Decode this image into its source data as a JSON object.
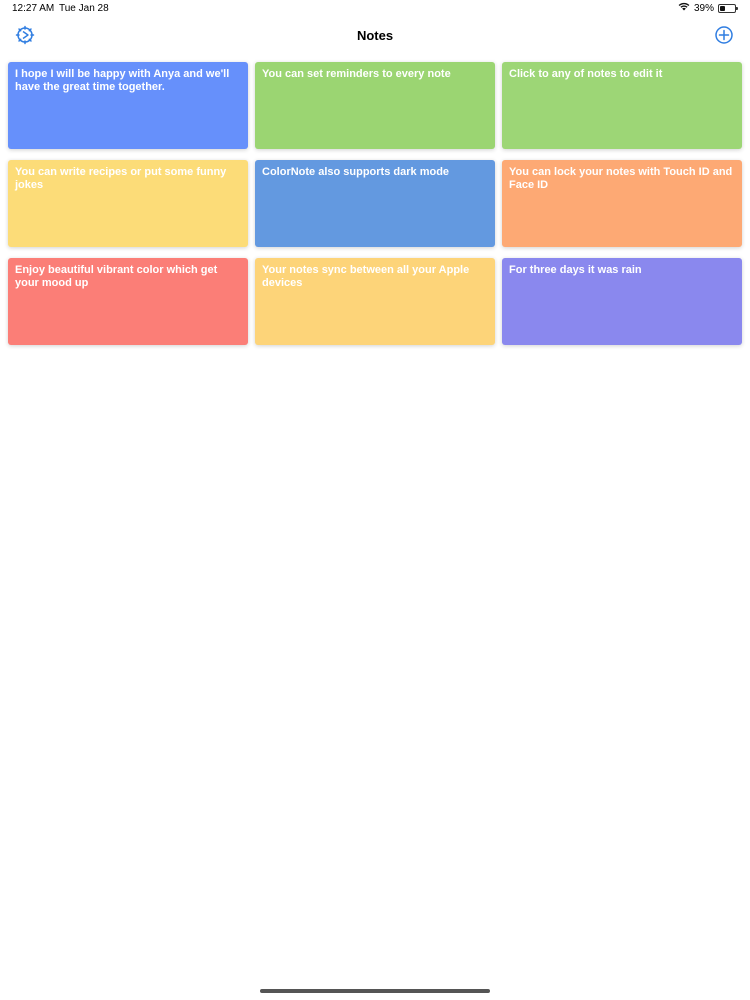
{
  "status_bar": {
    "time": "12:27 AM",
    "date": "Tue Jan 28",
    "battery": "39%",
    "battery_level": 0.39
  },
  "nav": {
    "title": "Notes",
    "left_icon": "settings-gear-icon",
    "right_icon": "add-circle-icon",
    "accent_color": "#2f7de1"
  },
  "notes": [
    {
      "text": "I hope I will be happy with Anya and we'll have the great time together.",
      "color": "#6690fb"
    },
    {
      "text": "You can set reminders to every note",
      "color": "#9bd572"
    },
    {
      "text": "Click to any of notes to edit it",
      "color": "#9dd676"
    },
    {
      "text": "You can write recipes or put some funny jokes",
      "color": "#fcdc78"
    },
    {
      "text": "ColorNote also supports dark mode",
      "color": "#6399e0"
    },
    {
      "text": "You can lock your notes with Touch ID and Face ID",
      "color": "#fda974"
    },
    {
      "text": "Enjoy beautiful vibrant color which get your mood up",
      "color": "#fb7e77"
    },
    {
      "text": "Your notes sync between all your Apple devices",
      "color": "#fdd479"
    },
    {
      "text": "For three days it was rain",
      "color": "#8a88ee"
    }
  ]
}
